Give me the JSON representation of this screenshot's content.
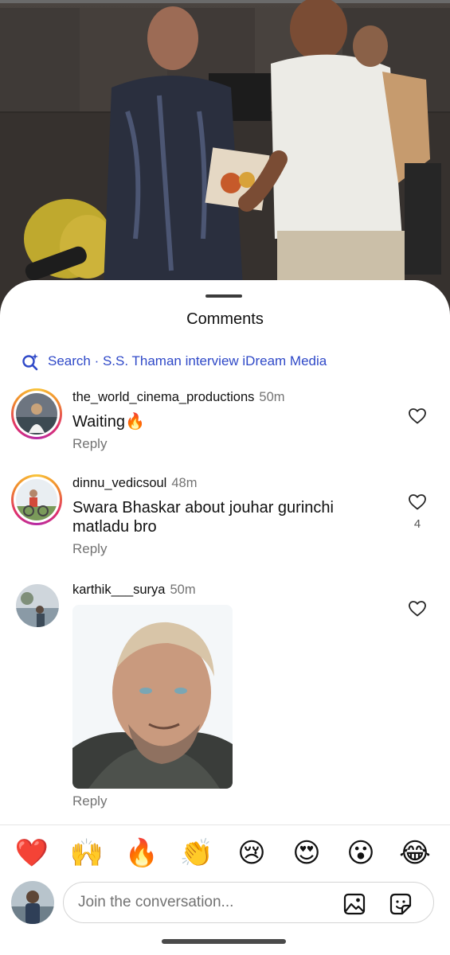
{
  "sheet": {
    "title": "Comments",
    "search_text": "Search · S.S. Thaman interview iDream Media"
  },
  "comments": [
    {
      "username": "the_world_cinema_productions",
      "time": "50m",
      "text": "Waiting🔥",
      "reply_label": "Reply",
      "likes": ""
    },
    {
      "username": "dinnu_vedicsoul",
      "time": "48m",
      "text": "Swara Bhaskar about jouhar gurinchi matladu bro",
      "reply_label": "Reply",
      "likes": "4"
    },
    {
      "username": "karthik___surya",
      "time": "50m",
      "text": "",
      "reply_label": "Reply",
      "likes": ""
    }
  ],
  "emoji_bar": [
    "❤️",
    "🙌",
    "🔥",
    "👏",
    "😢",
    "😍",
    "😮",
    "😂"
  ],
  "compose": {
    "placeholder": "Join the conversation..."
  },
  "icons": {
    "search": "search-sparkle-icon",
    "like": "heart-outline-icon",
    "gallery": "gallery-icon",
    "sticker": "sticker-icon"
  },
  "colors": {
    "link_blue": "#2f49c8",
    "muted": "#737373",
    "ring_gradient": [
      "#f9c53b",
      "#e0306a",
      "#b62ca6"
    ]
  }
}
